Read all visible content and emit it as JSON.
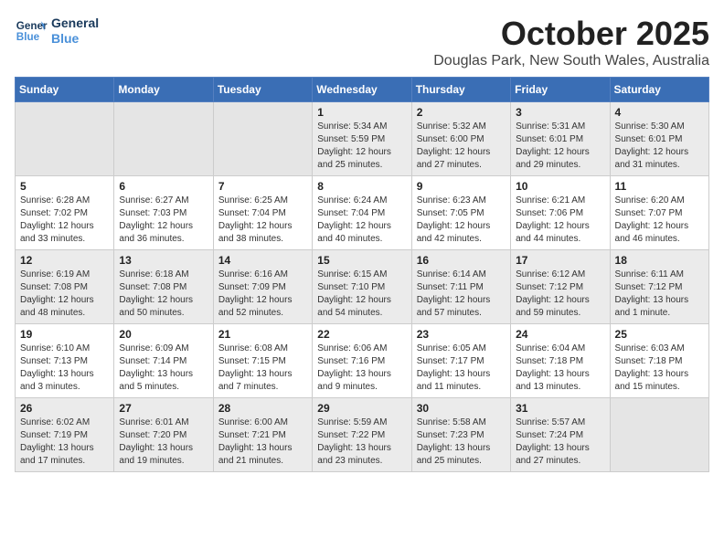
{
  "logo": {
    "line1": "General",
    "line2": "Blue"
  },
  "title": "October 2025",
  "location": "Douglas Park, New South Wales, Australia",
  "days_of_week": [
    "Sunday",
    "Monday",
    "Tuesday",
    "Wednesday",
    "Thursday",
    "Friday",
    "Saturday"
  ],
  "weeks": [
    [
      {
        "day": "",
        "empty": true
      },
      {
        "day": "",
        "empty": true
      },
      {
        "day": "",
        "empty": true
      },
      {
        "day": "1",
        "rise": "5:34 AM",
        "set": "5:59 PM",
        "daylight": "12 hours and 25 minutes."
      },
      {
        "day": "2",
        "rise": "5:32 AM",
        "set": "6:00 PM",
        "daylight": "12 hours and 27 minutes."
      },
      {
        "day": "3",
        "rise": "5:31 AM",
        "set": "6:01 PM",
        "daylight": "12 hours and 29 minutes."
      },
      {
        "day": "4",
        "rise": "5:30 AM",
        "set": "6:01 PM",
        "daylight": "12 hours and 31 minutes."
      }
    ],
    [
      {
        "day": "5",
        "rise": "6:28 AM",
        "set": "7:02 PM",
        "daylight": "12 hours and 33 minutes."
      },
      {
        "day": "6",
        "rise": "6:27 AM",
        "set": "7:03 PM",
        "daylight": "12 hours and 36 minutes."
      },
      {
        "day": "7",
        "rise": "6:25 AM",
        "set": "7:04 PM",
        "daylight": "12 hours and 38 minutes."
      },
      {
        "day": "8",
        "rise": "6:24 AM",
        "set": "7:04 PM",
        "daylight": "12 hours and 40 minutes."
      },
      {
        "day": "9",
        "rise": "6:23 AM",
        "set": "7:05 PM",
        "daylight": "12 hours and 42 minutes."
      },
      {
        "day": "10",
        "rise": "6:21 AM",
        "set": "7:06 PM",
        "daylight": "12 hours and 44 minutes."
      },
      {
        "day": "11",
        "rise": "6:20 AM",
        "set": "7:07 PM",
        "daylight": "12 hours and 46 minutes."
      }
    ],
    [
      {
        "day": "12",
        "rise": "6:19 AM",
        "set": "7:08 PM",
        "daylight": "12 hours and 48 minutes."
      },
      {
        "day": "13",
        "rise": "6:18 AM",
        "set": "7:08 PM",
        "daylight": "12 hours and 50 minutes."
      },
      {
        "day": "14",
        "rise": "6:16 AM",
        "set": "7:09 PM",
        "daylight": "12 hours and 52 minutes."
      },
      {
        "day": "15",
        "rise": "6:15 AM",
        "set": "7:10 PM",
        "daylight": "12 hours and 54 minutes."
      },
      {
        "day": "16",
        "rise": "6:14 AM",
        "set": "7:11 PM",
        "daylight": "12 hours and 57 minutes."
      },
      {
        "day": "17",
        "rise": "6:12 AM",
        "set": "7:12 PM",
        "daylight": "12 hours and 59 minutes."
      },
      {
        "day": "18",
        "rise": "6:11 AM",
        "set": "7:12 PM",
        "daylight": "13 hours and 1 minute."
      }
    ],
    [
      {
        "day": "19",
        "rise": "6:10 AM",
        "set": "7:13 PM",
        "daylight": "13 hours and 3 minutes."
      },
      {
        "day": "20",
        "rise": "6:09 AM",
        "set": "7:14 PM",
        "daylight": "13 hours and 5 minutes."
      },
      {
        "day": "21",
        "rise": "6:08 AM",
        "set": "7:15 PM",
        "daylight": "13 hours and 7 minutes."
      },
      {
        "day": "22",
        "rise": "6:06 AM",
        "set": "7:16 PM",
        "daylight": "13 hours and 9 minutes."
      },
      {
        "day": "23",
        "rise": "6:05 AM",
        "set": "7:17 PM",
        "daylight": "13 hours and 11 minutes."
      },
      {
        "day": "24",
        "rise": "6:04 AM",
        "set": "7:18 PM",
        "daylight": "13 hours and 13 minutes."
      },
      {
        "day": "25",
        "rise": "6:03 AM",
        "set": "7:18 PM",
        "daylight": "13 hours and 15 minutes."
      }
    ],
    [
      {
        "day": "26",
        "rise": "6:02 AM",
        "set": "7:19 PM",
        "daylight": "13 hours and 17 minutes."
      },
      {
        "day": "27",
        "rise": "6:01 AM",
        "set": "7:20 PM",
        "daylight": "13 hours and 19 minutes."
      },
      {
        "day": "28",
        "rise": "6:00 AM",
        "set": "7:21 PM",
        "daylight": "13 hours and 21 minutes."
      },
      {
        "day": "29",
        "rise": "5:59 AM",
        "set": "7:22 PM",
        "daylight": "13 hours and 23 minutes."
      },
      {
        "day": "30",
        "rise": "5:58 AM",
        "set": "7:23 PM",
        "daylight": "13 hours and 25 minutes."
      },
      {
        "day": "31",
        "rise": "5:57 AM",
        "set": "7:24 PM",
        "daylight": "13 hours and 27 minutes."
      },
      {
        "day": "",
        "empty": true
      }
    ]
  ]
}
